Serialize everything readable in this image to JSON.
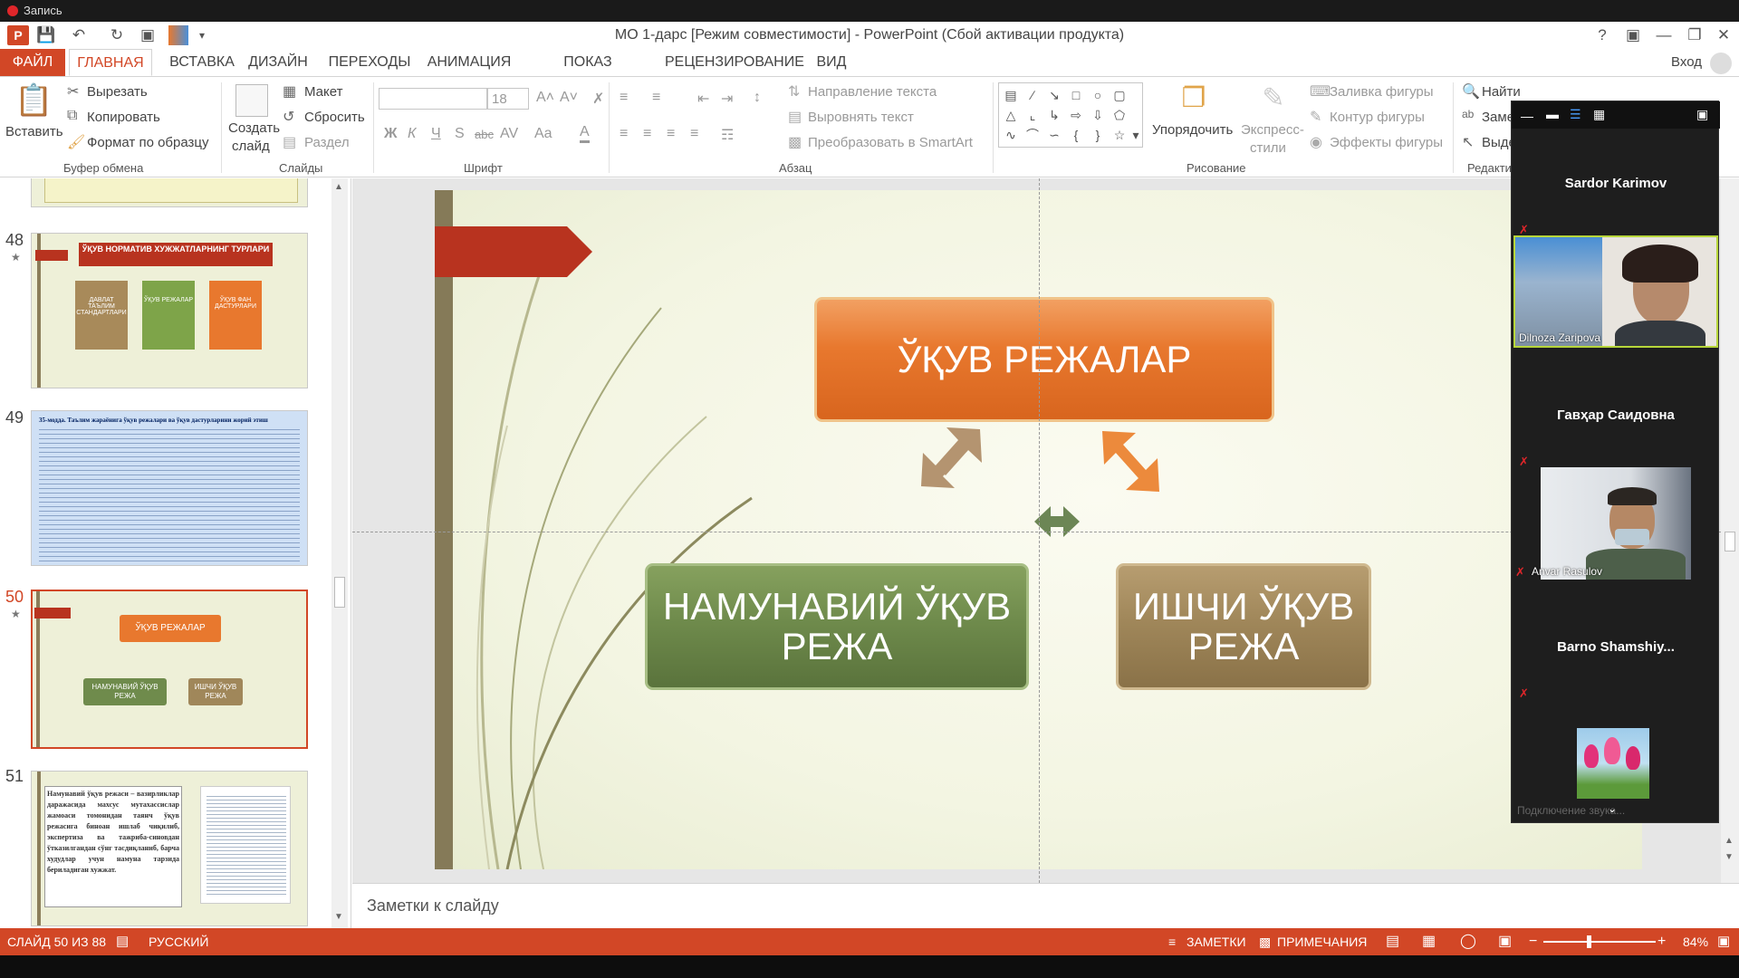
{
  "recording": {
    "label": "Запись"
  },
  "window": {
    "title": "МО 1-дарс [Режим совместимости] - PowerPoint (Сбой активации продукта)",
    "help": "?",
    "signin": "Вход"
  },
  "tabs": [
    "ФАЙЛ",
    "ГЛАВНАЯ",
    "ВСТАВКА",
    "ДИЗАЙН",
    "ПЕРЕХОДЫ",
    "АНИМАЦИЯ",
    "ПОКАЗ СЛАЙДОВ",
    "РЕЦЕНЗИРОВАНИЕ",
    "ВИД"
  ],
  "ribbon": {
    "clipboard": {
      "paste": "Вставить",
      "cut": "Вырезать",
      "copy": "Копировать",
      "format_painter": "Формат по образцу",
      "group": "Буфер обмена"
    },
    "slides": {
      "new_slide": "Создать",
      "new_slide2": "слайд",
      "layout": "Макет",
      "reset": "Сбросить",
      "section": "Раздел",
      "group": "Слайды"
    },
    "font": {
      "size": "18",
      "bold": "Ж",
      "italic": "К",
      "underline": "Ч",
      "shadow": "S",
      "strike": "abc",
      "spacing": "AV",
      "case": "Aa",
      "color": "A",
      "group": "Шрифт"
    },
    "paragraph": {
      "text_direction": "Направление текста",
      "align_text": "Выровнять текст",
      "smartart": "Преобразовать в SmartArt",
      "group": "Абзац"
    },
    "drawing": {
      "arrange": "Упорядочить",
      "quick_styles": "Экспресс-",
      "quick_styles2": "стили",
      "fill": "Заливка фигуры",
      "outline": "Контур фигуры",
      "effects": "Эффекты фигуры",
      "group": "Рисование"
    },
    "editing": {
      "find": "Найти",
      "replace": "Заме",
      "select": "Выде",
      "group": "Редактир"
    }
  },
  "thumbnails": [
    {
      "num": "48",
      "title": "ЎҚУВ НОРМАТИВ ХУЖЖАТЛАРНИНГ ТУРЛАРИ",
      "items": [
        "ДАВЛАТ ТАЪЛИМ СТАНДАРТЛАРИ",
        "ЎҚУВ РЕЖАЛАР",
        "ЎҚУВ ФАН ДАСТУРЛАРИ"
      ]
    },
    {
      "num": "49",
      "heading": "35-модда. Таълим жараёнига ўқув режалари ва ўқув дастурларини жорий этиш"
    },
    {
      "num": "50",
      "title": "ЎҚУВ РЕЖАЛАР",
      "left": "НАМУНАВИЙ ЎҚУВ РЕЖА",
      "right": "ИШЧИ ЎҚУВ РЕЖА"
    },
    {
      "num": "51",
      "text": "Намунавий ўқув режаси – вазирликлар даражасида махсус мутахассислар жамоаси томонидан таянч ўқув режасига биноан ишлаб чиқилиб, экспертиза ва тажриба-синовдан ўтказилгандан сўнг тасдиқланиб, барча худудлар учун намуна тарзида бериладиган хужжат."
    }
  ],
  "slide": {
    "top_box": "ЎҚУВ РЕЖАЛАР",
    "left_box": "НАМУНАВИЙ ЎҚУВ РЕЖА",
    "right_box": "ИШЧИ ЎҚУВ РЕЖА",
    "notes_placeholder": "Заметки к слайду"
  },
  "participants": [
    {
      "name": "Sardor Karimov",
      "video": false
    },
    {
      "name": "Dilnoza Zaripova",
      "video": true
    },
    {
      "name": "Гавҳар Саидовна",
      "video": false
    },
    {
      "name": "Anvar Rasulov",
      "video": true
    },
    {
      "name": "Barno  Shamshiy...",
      "video": false
    },
    {
      "name": "Подключение звука...",
      "video": "image"
    }
  ],
  "status": {
    "slide": "СЛАЙД 50 ИЗ 88",
    "language": "РУССКИЙ",
    "notes": "ЗАМЕТКИ",
    "comments": "ПРИМЕЧАНИЯ",
    "zoom": "84%"
  },
  "colors": {
    "accent": "#d24726",
    "orange_box": "#e8782e",
    "green_box": "#6f8b4c",
    "brown_box": "#a0875a",
    "red_tab": "#b8331f"
  }
}
